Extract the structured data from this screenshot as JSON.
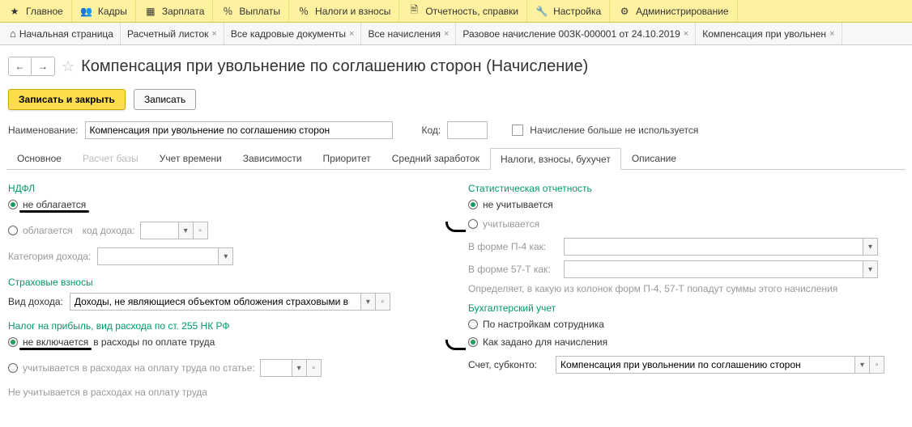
{
  "topbar": [
    {
      "icon": "star-icon",
      "label": "Главное"
    },
    {
      "icon": "people-icon",
      "label": "Кадры"
    },
    {
      "icon": "calendar-icon",
      "label": "Зарплата"
    },
    {
      "icon": "percent-icon",
      "label": "Выплаты"
    },
    {
      "icon": "percent2-icon",
      "label": "Налоги и взносы"
    },
    {
      "icon": "doc-icon",
      "label": "Отчетность, справки"
    },
    {
      "icon": "wrench-icon",
      "label": "Настройка"
    },
    {
      "icon": "gear-icon",
      "label": "Администрирование"
    }
  ],
  "tabs": [
    {
      "label": "Начальная страница",
      "home": true
    },
    {
      "label": "Расчетный листок",
      "closable": true
    },
    {
      "label": "Все кадровые документы",
      "closable": true
    },
    {
      "label": "Все начисления",
      "closable": true
    },
    {
      "label": "Разовое начисление 00ЗК-000001 от 24.10.2019",
      "closable": true
    },
    {
      "label": "Компенсация при увольнен",
      "closable": true
    }
  ],
  "nav": {
    "back": "←",
    "fwd": "→"
  },
  "page_title": "Компенсация при увольнение по соглашению сторон (Начисление)",
  "buttons": {
    "save_close": "Записать и закрыть",
    "save": "Записать"
  },
  "header_fields": {
    "name_label": "Наименование:",
    "name_value": "Компенсация при увольнение по соглашению сторон",
    "code_label": "Код:",
    "code_value": "",
    "unused_label": "Начисление больше не используется"
  },
  "subtabs": [
    "Основное",
    "Расчет базы",
    "Учет времени",
    "Зависимости",
    "Приоритет",
    "Средний заработок",
    "Налоги, взносы, бухучет",
    "Описание"
  ],
  "subtab_active": 6,
  "subtab_disabled": 1,
  "left": {
    "ndfl_title": "НДФЛ",
    "ndfl_opt1": "не облагается",
    "ndfl_opt2": "облагается",
    "income_code_label": "код дохода:",
    "income_cat_label": "Категория дохода:",
    "insurance_title": "Страховые взносы",
    "income_type_label": "Вид дохода:",
    "income_type_value": "Доходы, не являющиеся объектом обложения страховыми в",
    "profit_tax_title": "Налог на прибыль, вид расхода по ст. 255 НК РФ",
    "profit_opt1": "не включается",
    "profit_opt1_suffix": " в расходы по оплате труда",
    "profit_opt2": "учитывается в расходах на оплату труда по статье:",
    "profit_info": "Не учитывается в расходах на оплату труда"
  },
  "right": {
    "stat_title": "Статистическая отчетность",
    "stat_opt1": "не учитывается",
    "stat_opt2": "учитывается",
    "p4_label": "В форме П-4 как:",
    "p57_label": "В форме 57-Т как:",
    "note": "Определяет, в какую из колонок форм П-4, 57-Т попадут суммы этого начисления",
    "accounting_title": "Бухгалтерский учет",
    "acc_opt1": "По настройкам сотрудника",
    "acc_opt2": "Как задано для начисления",
    "account_label": "Счет, субконто:",
    "account_value": "Компенсация при увольнении по соглашению сторон"
  },
  "glyphs": {
    "dd": "▾",
    "open": "▫",
    "close": "×",
    "home": "⌂"
  }
}
